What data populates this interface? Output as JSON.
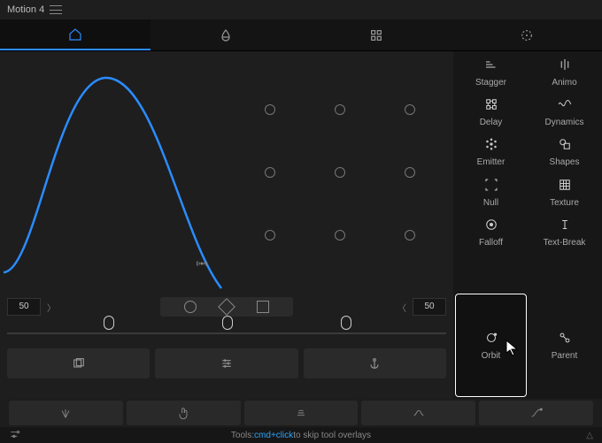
{
  "app": {
    "title": "Motion 4"
  },
  "tabs": [
    {
      "id": "home",
      "name": "home-tab"
    },
    {
      "id": "blend",
      "name": "blend-tab"
    },
    {
      "id": "grid",
      "name": "grid-tab"
    },
    {
      "id": "target",
      "name": "target-tab"
    }
  ],
  "active_tab": "home",
  "values": {
    "left": "50",
    "right": "50"
  },
  "tools": [
    {
      "label": "Stagger",
      "name": "stagger-tool"
    },
    {
      "label": "Animo",
      "name": "animo-tool"
    },
    {
      "label": "Delay",
      "name": "delay-tool"
    },
    {
      "label": "Dynamics",
      "name": "dynamics-tool"
    },
    {
      "label": "Emitter",
      "name": "emitter-tool"
    },
    {
      "label": "Shapes",
      "name": "shapes-tool"
    },
    {
      "label": "Null",
      "name": "null-tool"
    },
    {
      "label": "Texture",
      "name": "texture-tool"
    },
    {
      "label": "Falloff",
      "name": "falloff-tool"
    },
    {
      "label": "Text-Break",
      "name": "text-break-tool"
    },
    {
      "label": "Orbit",
      "name": "orbit-tool",
      "active": true
    },
    {
      "label": "Parent",
      "name": "parent-tool"
    }
  ],
  "footer": {
    "prefix": "Tools: ",
    "kbd": "cmd+click",
    "suffix": " to skip tool overlays"
  },
  "chart_data": {
    "type": "line",
    "title": "",
    "description": "Bell-shaped easing curve",
    "x": [
      0,
      0.12,
      0.25,
      0.42,
      0.55,
      0.7,
      0.85,
      1.0
    ],
    "y": [
      0.08,
      0.45,
      0.88,
      1.0,
      0.85,
      0.55,
      0.25,
      0.02
    ],
    "xlim": [
      0,
      1
    ],
    "ylim": [
      0,
      1
    ],
    "color": "#2a8cff"
  }
}
